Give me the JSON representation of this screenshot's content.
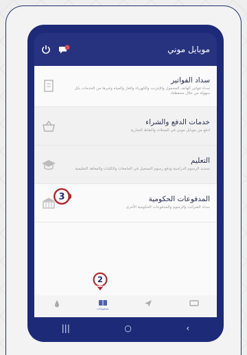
{
  "appbar": {
    "title": "موبايل موني"
  },
  "services": [
    {
      "title": "سداد الفواتير",
      "desc": "سداد فواتير الهاتف المحمول والإنترنت والكهرباء والغاز والمياه وغيرها من الخدمات بكل سهولة من خلال محفظتك"
    },
    {
      "title": "خدمات الدفع والشراء",
      "desc": "ادفع من موبايل موني في المحلات والنقاط التجارية"
    },
    {
      "title": "التعليم",
      "desc": "تسديد الرسوم الدراسية ودفع رسوم التسجيل في الجامعات والكليات والمعاهد التعليمية"
    },
    {
      "title": "المدفوعات الحكومية",
      "desc": "سداد الضرائب والرسوم والمدفوعات الحكومية الأخرى"
    }
  ],
  "bottomnav": {
    "items": [
      {
        "label": "",
        "icon": "drop-icon"
      },
      {
        "label": "مدفوعات",
        "icon": "card-icon"
      },
      {
        "label": "",
        "icon": "send-icon"
      },
      {
        "label": "",
        "icon": "wallet-icon"
      }
    ]
  },
  "markers": {
    "m2": "2",
    "m3": "3"
  },
  "colors": {
    "navy": "#1d2a78",
    "marker": "#b1292f"
  }
}
